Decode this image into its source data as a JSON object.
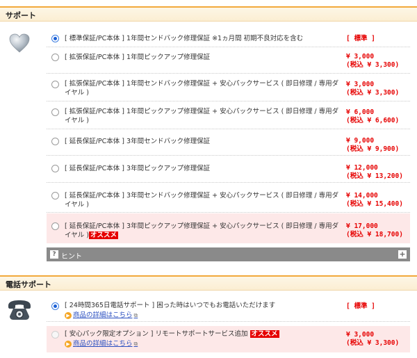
{
  "support": {
    "title": "サポート",
    "icon": "heart-icon",
    "options": [
      {
        "label": "[ 標準保証/PC本体 ] 1年間センドバック修理保証 ※1ヵ月間 初期不良対応を含む",
        "price": "[ 標準 ]",
        "price_tax": "",
        "badge": "",
        "checked": true
      },
      {
        "label": "[ 拡張保証/PC本体 ] 1年間ピックアップ修理保証",
        "price": "¥ 3,000",
        "price_tax": "(税込 ¥ 3,300)",
        "badge": "",
        "checked": false
      },
      {
        "label": "[ 拡張保証/PC本体 ] 1年間センドバック修理保証 + 安心パックサービス ( 即日修理 / 専用ダイヤル )",
        "price": "¥ 3,000",
        "price_tax": "(税込 ¥ 3,300)",
        "badge": "",
        "checked": false
      },
      {
        "label": "[ 拡張保証/PC本体 ] 1年間ピックアップ修理保証 + 安心パックサービス ( 即日修理 / 専用ダイヤル )",
        "price": "¥ 6,000",
        "price_tax": "(税込 ¥ 6,600)",
        "badge": "",
        "checked": false
      },
      {
        "label": "[ 延長保証/PC本体 ] 3年間センドバック修理保証",
        "price": "¥ 9,000",
        "price_tax": "(税込 ¥ 9,900)",
        "badge": "",
        "checked": false
      },
      {
        "label": "[ 延長保証/PC本体 ] 3年間ピックアップ修理保証",
        "price": "¥ 12,000",
        "price_tax": "(税込 ¥ 13,200)",
        "badge": "",
        "checked": false
      },
      {
        "label": "[ 延長保証/PC本体 ] 3年間センドバック修理保証 + 安心パックサービス ( 即日修理 / 専用ダイヤル )",
        "price": "¥ 14,000",
        "price_tax": "(税込 ¥ 15,400)",
        "badge": "",
        "checked": false
      },
      {
        "label": "[ 延長保証/PC本体 ] 3年間ピックアップ修理保証 + 安心パックサービス ( 即日修理 / 専用ダイヤル )",
        "price": "¥ 17,000",
        "price_tax": "(税込 ¥ 18,700)",
        "badge": "オススメ",
        "checked": false
      }
    ],
    "hint_label": "ヒント",
    "hint_icon": "question-icon",
    "expand_icon": "plus-icon"
  },
  "phone_support": {
    "title": "電話サポート",
    "icon": "telephone-icon",
    "options": [
      {
        "label": "[ 24時間365日電話サポート ] 困った時はいつでもお電話いただけます",
        "link": "商品の詳細はこちら",
        "price": "[ 標準 ]",
        "price_tax": "",
        "badge": "",
        "checked": true
      },
      {
        "label": "[ 安心パック限定オプション ] リモートサポートサービス追加",
        "link": "商品の詳細はこちら",
        "price": "¥ 3,000",
        "price_tax": "(税込 ¥ 3,300)",
        "badge": "オススメ",
        "checked": false,
        "disabled": true
      }
    ]
  },
  "colors": {
    "accent": "#f2a93b",
    "price": "#e60000",
    "badge_bg": "#e60000",
    "highlight_row": "#fde8e8",
    "hint_bar": "#8a8a8a",
    "link": "#2a4fc0"
  }
}
